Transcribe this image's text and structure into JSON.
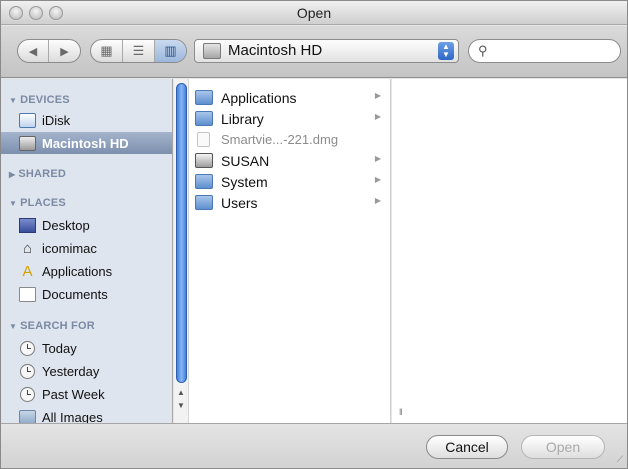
{
  "window": {
    "title": "Open"
  },
  "toolbar": {
    "nav": {
      "back_icon": "back-arrow-icon",
      "forward_icon": "forward-arrow-icon"
    },
    "view_modes": [
      {
        "name": "icon-view",
        "glyph": "▦"
      },
      {
        "name": "list-view",
        "glyph": "☰"
      },
      {
        "name": "column-view",
        "glyph": "▥",
        "active": true
      }
    ],
    "location": "Macintosh HD",
    "search": {
      "placeholder": ""
    }
  },
  "sidebar": {
    "sections": [
      {
        "heading": "DEVICES",
        "expanded": true,
        "items": [
          {
            "label": "iDisk",
            "icon": "idisk-icon"
          },
          {
            "label": "Macintosh HD",
            "icon": "hard-drive-icon",
            "selected": true
          }
        ]
      },
      {
        "heading": "SHARED",
        "expanded": false,
        "items": []
      },
      {
        "heading": "PLACES",
        "expanded": true,
        "items": [
          {
            "label": "Desktop",
            "icon": "desktop-icon"
          },
          {
            "label": "icomimac",
            "icon": "home-icon"
          },
          {
            "label": "Applications",
            "icon": "applications-icon"
          },
          {
            "label": "Documents",
            "icon": "documents-icon"
          }
        ]
      },
      {
        "heading": "SEARCH FOR",
        "expanded": true,
        "items": [
          {
            "label": "Today",
            "icon": "clock-icon"
          },
          {
            "label": "Yesterday",
            "icon": "clock-icon"
          },
          {
            "label": "Past Week",
            "icon": "clock-icon"
          },
          {
            "label": "All Images",
            "icon": "images-folder-icon"
          }
        ]
      }
    ]
  },
  "browser": {
    "column1": [
      {
        "label": "Applications",
        "icon": "applications-folder-icon",
        "has_children": true,
        "enabled": true
      },
      {
        "label": "Library",
        "icon": "library-folder-icon",
        "has_children": true,
        "enabled": true
      },
      {
        "label": "Smartvie...-221.dmg",
        "icon": "disk-image-file-icon",
        "has_children": false,
        "enabled": false
      },
      {
        "label": "SUSAN",
        "icon": "drive-icon",
        "has_children": true,
        "enabled": true
      },
      {
        "label": "System",
        "icon": "system-folder-icon",
        "has_children": true,
        "enabled": true
      },
      {
        "label": "Users",
        "icon": "users-folder-icon",
        "has_children": true,
        "enabled": true
      }
    ]
  },
  "buttons": {
    "cancel": "Cancel",
    "open": "Open"
  },
  "colors": {
    "selection": "#7c8fae",
    "scroll_thumb": "#3f7fe0",
    "sidebar_bg": "#dfe5ee"
  }
}
